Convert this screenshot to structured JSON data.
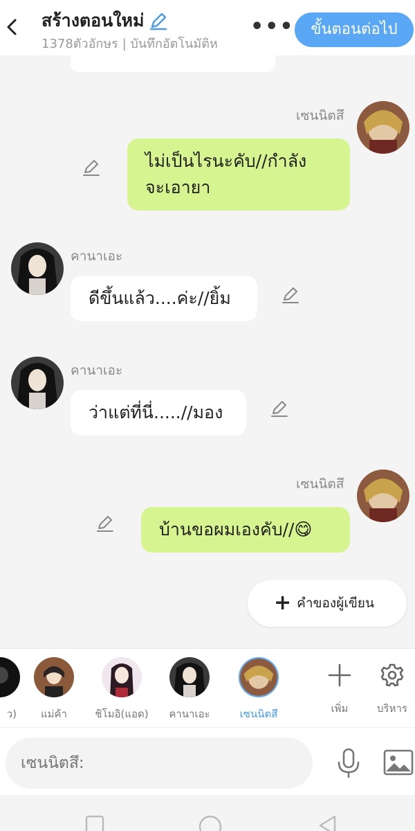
{
  "header": {
    "back_icon": "back-arrow-icon",
    "title": "สร้างตอนใหม่",
    "subtitle": "1378ตัวอักษร | บันทึกอัตโนมัติห",
    "more_label": "•••",
    "next_label": "ขั้นตอนต่อไป"
  },
  "messages": [
    {
      "sender": "เซนนิตสึ",
      "side": "right",
      "text_lines": [
        "ไม่เป็นไรนะคับ//กำลัง",
        "จะเอายา"
      ]
    },
    {
      "sender": "คานาเอะ",
      "side": "left",
      "text": "ดีขึ้นแล้ว....ค่ะ//ยิ้ม"
    },
    {
      "sender": "คานาเอะ",
      "side": "left",
      "text": "ว่าแต่ที่นี่.....//มอง"
    },
    {
      "sender": "เซนนิตสึ",
      "side": "right",
      "text": "บ้านขอผมเองคับ//😋"
    }
  ],
  "writer_button": {
    "plus": "+",
    "label": "คำของผู้เขียน"
  },
  "characters": [
    {
      "label": "ว)"
    },
    {
      "label": "แม่ค้า"
    },
    {
      "label": "ชิโมอิ(แอด)"
    },
    {
      "label": "คานาเอะ"
    },
    {
      "label": "เซนนิตสึ",
      "active": true
    }
  ],
  "tools": {
    "add_label": "เพิ่ม",
    "manage_label": "บริหาร"
  },
  "input": {
    "placeholder": "เซนนิตสึ:"
  },
  "colors": {
    "accent": "#5aa8f5",
    "bubble_green": "#d6f590",
    "bubble_white": "#ffffff",
    "background": "#f4f4f4"
  }
}
